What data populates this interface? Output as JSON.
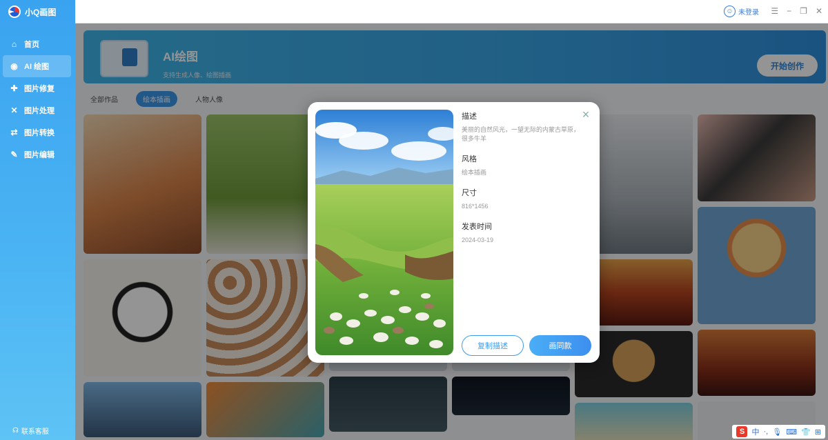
{
  "app": {
    "name": "小Q画图",
    "login": "未登录"
  },
  "sidebar": {
    "items": [
      {
        "label": "首页",
        "icon": "home-icon"
      },
      {
        "label": "AI 绘图",
        "icon": "palette-icon",
        "active": true
      },
      {
        "label": "图片修复",
        "icon": "repair-icon"
      },
      {
        "label": "图片处理",
        "icon": "tools-icon"
      },
      {
        "label": "图片转换",
        "icon": "convert-icon"
      },
      {
        "label": "图片编辑",
        "icon": "edit-icon"
      }
    ],
    "support": "联系客服"
  },
  "banner": {
    "title": "AI绘图",
    "subtitle": "支持生成人像、绘图插画",
    "start_button": "开始创作"
  },
  "tabs": [
    {
      "label": "全部作品",
      "active": false
    },
    {
      "label": "绘本插画",
      "active": true
    },
    {
      "label": "人物人像",
      "active": false
    }
  ],
  "modal": {
    "desc_label": "描述",
    "desc_value": "美丽的自然风光，一望无际的内蒙古草原，很多牛羊",
    "style_label": "风格",
    "style_value": "绘本插画",
    "size_label": "尺寸",
    "size_value": "816*1456",
    "time_label": "发表时间",
    "time_value": "2024-03-19",
    "copy_button": "复制描述",
    "same_button": "画同款"
  },
  "tray": {
    "ime": "中"
  },
  "colors": {
    "accent": "#3b98e8",
    "sidebar": "#4bb4f3"
  }
}
